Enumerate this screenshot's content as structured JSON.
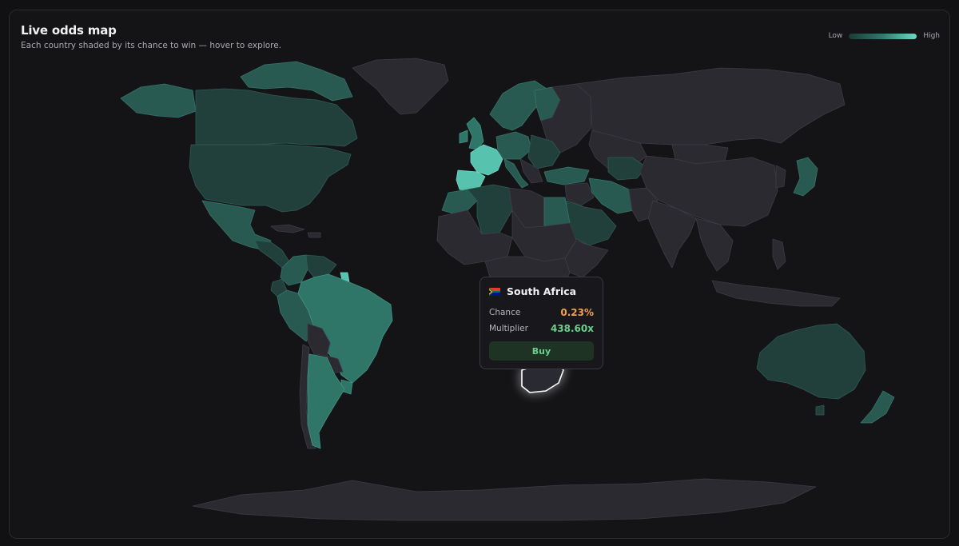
{
  "header": {
    "title": "Live odds map",
    "subtitle": "Each country shaded by its chance to win — hover to explore."
  },
  "legend": {
    "low_label": "Low",
    "high_label": "High",
    "low_color": "#1c3a35",
    "high_color": "#6fd8c4"
  },
  "colors": {
    "background": "#141417",
    "land_default": "#2a2a30",
    "highlight": "#57c2ae",
    "hover_outline": "#ffffff"
  },
  "tooltip": {
    "flag_icon": "south-africa-flag-icon",
    "country": "South Africa",
    "chance_label": "Chance",
    "chance_value": "0.23%",
    "multiplier_label": "Multiplier",
    "multiplier_value": "438.60x",
    "buy_label": "Buy"
  }
}
